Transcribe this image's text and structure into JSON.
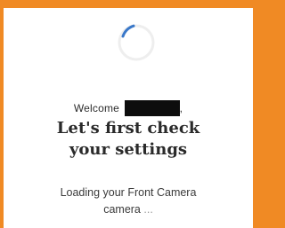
{
  "colors": {
    "frame": "#f08a24",
    "panel": "#ffffff",
    "text": "#2a2a2a",
    "spinner_arc": "#3a78c9",
    "spinner_track": "#eeeeee"
  },
  "icons": {
    "spinner": "loading-spinner-icon"
  },
  "welcome": {
    "prefix": "Welcome",
    "suffix": ","
  },
  "headline": {
    "line1": "Let's first check",
    "line2": "your settings"
  },
  "status": {
    "line1": "Loading your Front Camera",
    "line2_word": "camera",
    "line2_ellipsis": "..."
  }
}
